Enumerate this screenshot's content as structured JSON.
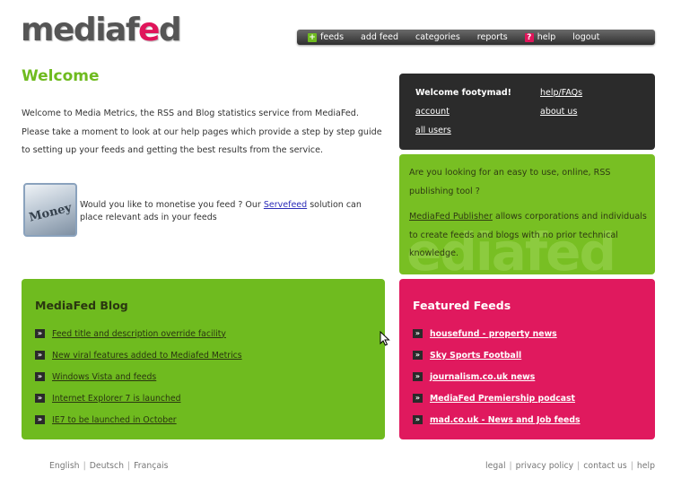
{
  "logo": {
    "part1": "mediaf",
    "part2": "e",
    "part3": "d"
  },
  "nav": {
    "items": [
      "feeds",
      "add feed",
      "categories",
      "reports",
      "help",
      "logout"
    ]
  },
  "main": {
    "title": "Welcome",
    "intro": "Welcome to Media Metrics, the RSS and Blog statistics service from MediaFed. Please take a moment to look at our help pages which provide a step by step guide to setting up your feeds and getting the best results from the service.",
    "monetise": {
      "thumb_text": "Money",
      "before": "Would you like to monetise you feed ? Our ",
      "link": "Servefeed",
      "after": " solution can place relevant ads in your feeds"
    }
  },
  "userbox": {
    "welcome": "Welcome footymad!",
    "account": "account",
    "all_users": "all users",
    "help_faqs": "help/FAQs",
    "about_us": "about us"
  },
  "promo": {
    "question": "Are you looking for an easy to use, online, RSS publishing tool ?",
    "publisher_link": "MediaFed Publisher",
    "publisher_text": " allows corporations and individuals to create feeds and blogs with no prior technical knowledge.",
    "watermark": "ediafed"
  },
  "blog": {
    "title": "MediaFed Blog",
    "items": [
      "Feed title and description override facility",
      "New viral features added to Mediafed Metrics",
      "Windows Vista and feeds",
      "Internet Explorer 7 is launched",
      "IE7 to be launched in October"
    ]
  },
  "featured": {
    "title": "Featured Feeds",
    "items": [
      "housefund - property news",
      "Sky Sports Football",
      "journalism.co.uk news",
      "MediaFed Premiership podcast",
      "mad.co.uk - News and Job feeds"
    ]
  },
  "footer": {
    "languages": [
      "English",
      "Deutsch",
      "Français"
    ],
    "links": [
      "legal",
      "privacy policy",
      "contact us",
      "help"
    ]
  },
  "icons": {
    "bullet": "»",
    "feeds_icon": "+",
    "help_icon": "?"
  },
  "colors": {
    "green": "#6fbb1f",
    "pink": "#e0195e",
    "dark": "#2b2b2b"
  }
}
